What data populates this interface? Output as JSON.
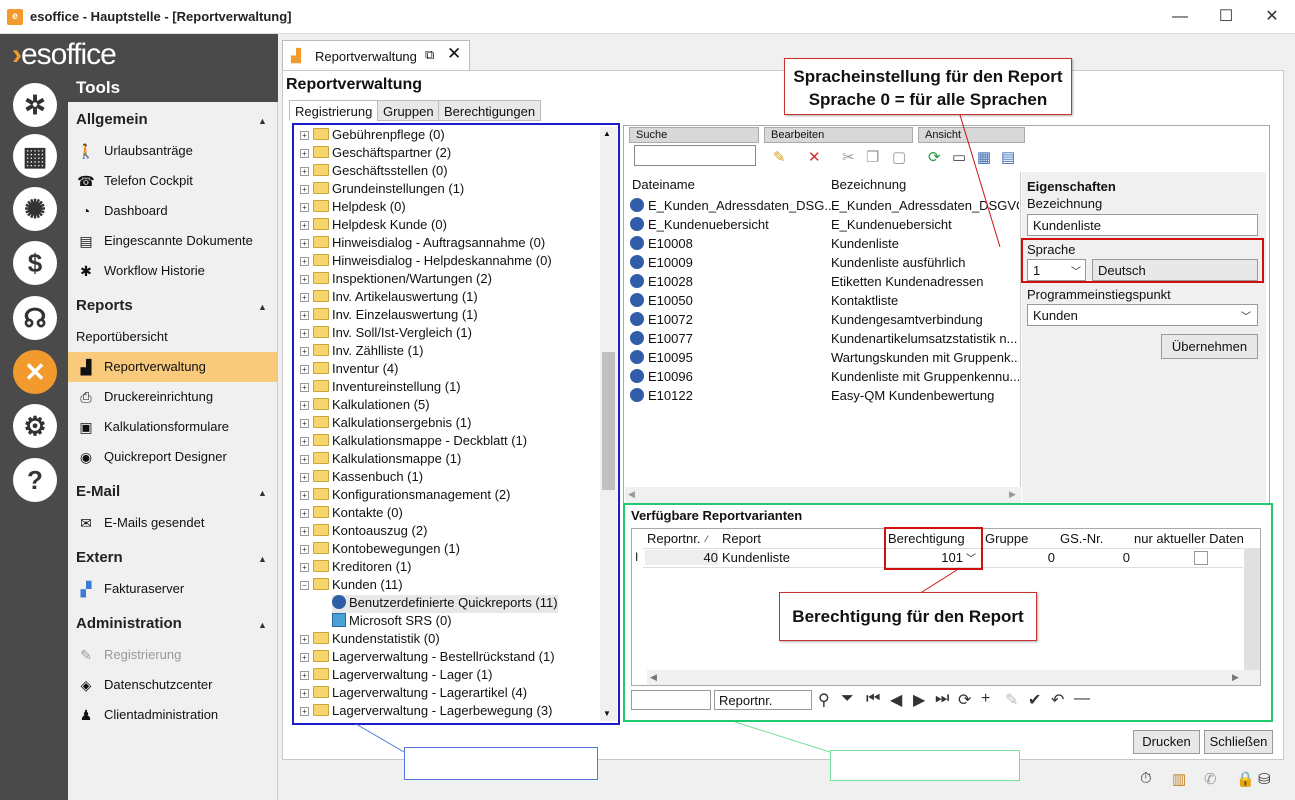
{
  "window": {
    "title": "esoffice - Hauptstelle - [Reportverwaltung]",
    "app_icon": "app-icon",
    "min": "—",
    "max": "☐",
    "close": "✕"
  },
  "brand": {
    "logo": "esoffice"
  },
  "rail": [
    "ship-wheel-icon",
    "abacus-icon",
    "alarm-light-icon",
    "cash-icon",
    "headset-icon",
    "tools-icon",
    "gears-icon",
    "help-icon"
  ],
  "nav": {
    "header": "Tools",
    "sections": [
      {
        "title": "Allgemein",
        "items": [
          "Urlaubsanträge",
          "Telefon Cockpit",
          "Dashboard",
          "Eingescannte Dokumente",
          "Workflow Historie"
        ]
      },
      {
        "title": "Reports",
        "items": [
          "Reportübersicht",
          "Reportverwaltung",
          "Druckereinrichtung",
          "Kalkulationsformulare",
          "Quickreport Designer"
        ]
      },
      {
        "title": "E-Mail",
        "items": [
          "E-Mails gesendet"
        ]
      },
      {
        "title": "Extern",
        "items": [
          "Fakturaserver"
        ]
      },
      {
        "title": "Administration",
        "items": [
          "Registrierung",
          "Datenschutzcenter",
          "Clientadministration"
        ]
      }
    ]
  },
  "tab": {
    "label": "Reportverwaltung"
  },
  "page": {
    "title": "Reportverwaltung",
    "subtabs": [
      "Registrierung",
      "Gruppen",
      "Berechtigungen"
    ]
  },
  "tree": {
    "items": [
      "Gebührenpflege (0)",
      "Geschäftspartner (2)",
      "Geschäftsstellen (0)",
      "Grundeinstellungen (1)",
      "Helpdesk (0)",
      "Helpdesk Kunde (0)",
      "Hinweisdialog - Auftragsannahme (0)",
      "Hinweisdialog - Helpdeskannahme (0)",
      "Inspektionen/Wartungen (2)",
      "Inv. Artikelauswertung (1)",
      "Inv. Einzelauswertung (1)",
      "Inv. Soll/Ist-Vergleich (1)",
      "Inv. Zählliste (1)",
      "Inventur (4)",
      "Inventureinstellung (1)",
      "Kalkulationen (5)",
      "Kalkulationsergebnis (1)",
      "Kalkulationsmappe - Deckblatt (1)",
      "Kalkulationsmappe (1)",
      "Kassenbuch (1)",
      "Konfigurationsmanagement (2)",
      "Kontakte (0)",
      "Kontoauszug (2)",
      "Kontobewegungen (1)",
      "Kreditoren (1)",
      "Kunden (11)"
    ],
    "sub": [
      "Benutzerdefinierte Quickreports (11)",
      "Microsoft SRS (0)"
    ],
    "after": [
      "Kundenstatistik (0)",
      "Lagerverwaltung - Bestellrückstand (1)",
      "Lagerverwaltung - Lager (1)",
      "Lagerverwaltung - Lagerartikel (4)",
      "Lagerverwaltung - Lagerbewegung (3)"
    ]
  },
  "toolbar": {
    "suche": "Suche",
    "bearbeiten": "Bearbeiten",
    "ansicht": "Ansicht"
  },
  "files": {
    "col_name": "Dateiname",
    "col_desc": "Bezeichnung",
    "rows": [
      {
        "name": "E_Kunden_Adressdaten_DSG...",
        "desc": "E_Kunden_Adressdaten_DSGVO"
      },
      {
        "name": "E_Kundenuebersicht",
        "desc": "E_Kundenuebersicht"
      },
      {
        "name": "E10008",
        "desc": "Kundenliste"
      },
      {
        "name": "E10009",
        "desc": "Kundenliste ausführlich"
      },
      {
        "name": "E10028",
        "desc": "Etiketten Kundenadressen"
      },
      {
        "name": "E10050",
        "desc": "Kontaktliste"
      },
      {
        "name": "E10072",
        "desc": "Kundengesamtverbindung"
      },
      {
        "name": "E10077",
        "desc": "Kundenartikelumsatzstatistik n..."
      },
      {
        "name": "E10095",
        "desc": "Wartungskunden mit Gruppenk..."
      },
      {
        "name": "E10096",
        "desc": "Kundenliste mit Gruppenkennu..."
      },
      {
        "name": "E10122",
        "desc": "Easy-QM Kundenbewertung"
      }
    ]
  },
  "props": {
    "title": "Eigenschaften",
    "bez_label": "Bezeichnung",
    "bez_value": "Kundenliste",
    "sprache_label": "Sprache",
    "sprache_nr": "1",
    "sprache_name": "Deutsch",
    "einstieg_label": "Programmeinstiegspunkt",
    "einstieg_value": "Kunden",
    "apply": "Übernehmen"
  },
  "variants": {
    "title": "Verfügbare Reportvarianten",
    "headers": [
      "Reportnr.",
      "Report",
      "Berechtigung",
      "Gruppe",
      "GS.-Nr.",
      "nur aktueller Daten"
    ],
    "row": {
      "nr": "40",
      "report": "Kundenliste",
      "berechtigung": "101",
      "gruppe": "0",
      "gsnr": "0"
    },
    "nav_field": "Reportnr."
  },
  "callouts": {
    "c1_line1": "Spracheinstellung für den Report",
    "c1_line2": "Sprache 0 = für alle Sprachen",
    "c2": "Berechtigung für den Report"
  },
  "buttons": {
    "drucken": "Drucken",
    "schliessen": "Schließen"
  }
}
